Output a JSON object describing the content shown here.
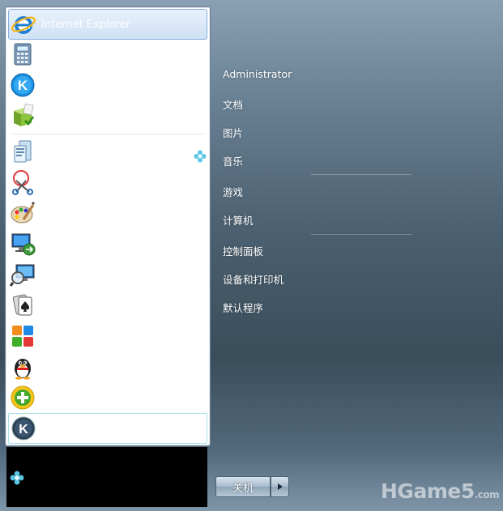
{
  "programs": [
    {
      "label": "Internet Explorer",
      "icon": "internet-explorer-icon"
    },
    {
      "label": "",
      "icon": "calculator-icon"
    },
    {
      "label": "",
      "icon": "kugou-music-icon"
    },
    {
      "label": "",
      "icon": "installer-package-icon"
    },
    {
      "label": "",
      "icon": "getting-started-icon"
    },
    {
      "label": "",
      "icon": "snipping-tool-icon"
    },
    {
      "label": "",
      "icon": "paint-icon"
    },
    {
      "label": "",
      "icon": "remote-desktop-icon"
    },
    {
      "label": "",
      "icon": "magnifier-icon"
    },
    {
      "label": "",
      "icon": "solitaire-icon"
    },
    {
      "label": "",
      "icon": "color-tiles-icon"
    },
    {
      "label": "",
      "icon": "qq-penguin-icon"
    },
    {
      "label": "",
      "icon": "plus-add-icon"
    },
    {
      "label": "",
      "icon": "kkbox-icon"
    }
  ],
  "right_menu": {
    "items": [
      "Administrator",
      "文档",
      "图片",
      "音乐",
      "游戏",
      "计算机",
      "控制面板",
      "设备和打印机",
      "默认程序"
    ]
  },
  "shutdown": {
    "label": "关机"
  },
  "watermark": {
    "brand": "HGame5",
    "domain": ".com"
  }
}
